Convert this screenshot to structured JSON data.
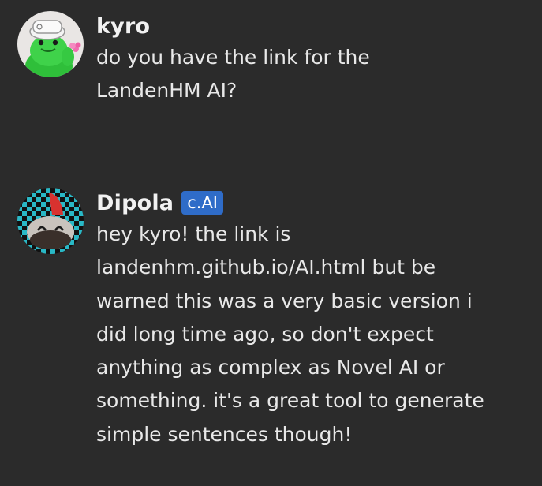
{
  "messages": [
    {
      "author": "kyro",
      "avatar_icon": "frog-avatar-icon",
      "text": "do you have the link for the LandenHM AI?"
    },
    {
      "author": "Dipola",
      "badge": "c.AI",
      "avatar_icon": "checkered-avatar-icon",
      "text": "hey kyro! the link is landenhm.github.io/AI.html but be warned this was a very basic version i did long time ago, so don't expect anything as complex as Novel AI or something. it's a great tool to generate simple sentences though!"
    }
  ],
  "colors": {
    "background": "#2b2b2b",
    "badge": "#2f6cc8",
    "text": "#e8e8e8"
  }
}
